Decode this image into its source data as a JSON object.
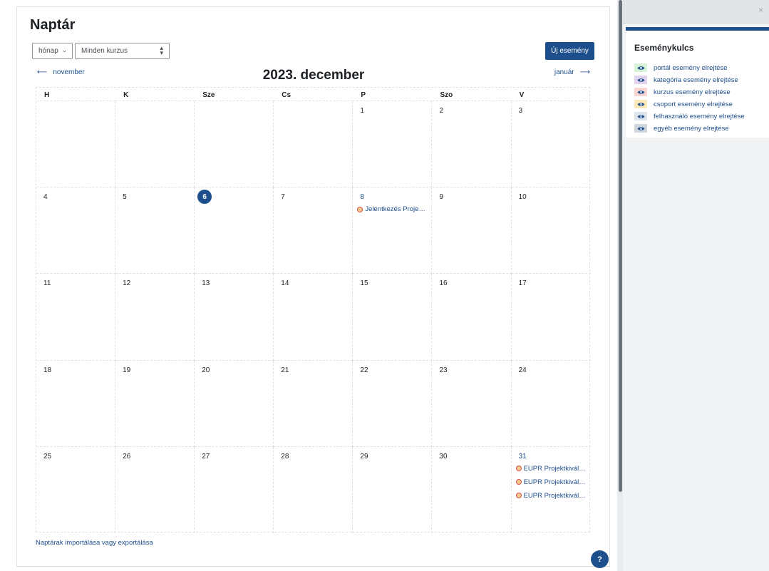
{
  "page": {
    "title": "Naptár"
  },
  "controls": {
    "view": "hónap",
    "course": "Minden kurzus",
    "new_event": "Új esemény"
  },
  "nav": {
    "prev": "november",
    "next": "január",
    "month": "2023. december"
  },
  "calendar": {
    "weekdays": [
      "H",
      "K",
      "Sze",
      "Cs",
      "P",
      "Szo",
      "V"
    ],
    "weeks": [
      [
        "",
        "",
        "",
        "",
        "1",
        "2",
        "3"
      ],
      [
        "4",
        "5",
        "6",
        "7",
        "8",
        "9",
        "10"
      ],
      [
        "11",
        "12",
        "13",
        "14",
        "15",
        "16",
        "17"
      ],
      [
        "18",
        "19",
        "20",
        "21",
        "22",
        "23",
        "24"
      ],
      [
        "25",
        "26",
        "27",
        "28",
        "29",
        "30",
        "31"
      ]
    ],
    "today": "6",
    "events": {
      "8": [
        "Jelentkezés Projektkiválasztás"
      ],
      "31": [
        "EUPR Projektkiválasztás",
        "EUPR Projektkiválasztás",
        "EUPR Projektkiválasztás"
      ]
    }
  },
  "footer": {
    "import_export": "Naptárak importálása vagy exportálása",
    "help": "?"
  },
  "drawer": {
    "close": "×",
    "legend_title": "Eseménykulcs",
    "items": [
      {
        "label": "portál esemény elrejtése",
        "color": "#d7f3d8"
      },
      {
        "label": "kategória esemény elrejtése",
        "color": "#e1d2ef"
      },
      {
        "label": "kurzus esemény elrejtése",
        "color": "#fbd5d1"
      },
      {
        "label": "csoport esemény elrejtése",
        "color": "#fde9b7"
      },
      {
        "label": "felhasználó esemény elrejtése",
        "color": "#dde5ec"
      },
      {
        "label": "egyéb esemény elrejtése",
        "color": "#cfd6de"
      }
    ]
  },
  "colors": {
    "accent": "#1e4f8d",
    "event_dot": "#d9534f"
  }
}
